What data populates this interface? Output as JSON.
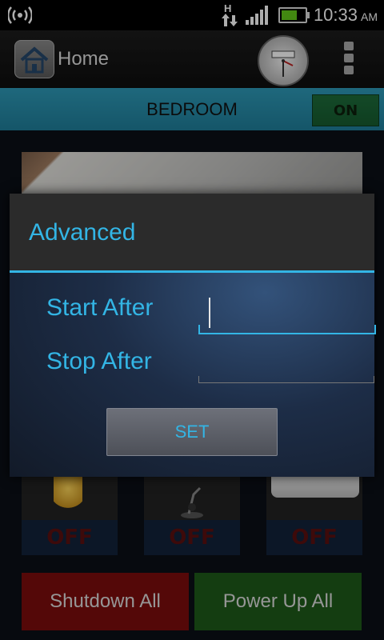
{
  "statusbar": {
    "time": "10:33",
    "ampm": "AM",
    "network_letter": "H"
  },
  "actionbar": {
    "title": "Home"
  },
  "room": {
    "name": "BEDROOM",
    "toggle_label": "ON"
  },
  "devices": [
    {
      "state": "OFF"
    },
    {
      "state": "OFF"
    },
    {
      "state": "OFF"
    }
  ],
  "buttons": {
    "shutdown_all": "Shutdown All",
    "power_up_all": "Power Up All"
  },
  "dialog": {
    "title": "Advanced",
    "start_label": "Start After",
    "start_value": "",
    "stop_label": "Stop After",
    "stop_value": "",
    "set_label": "SET"
  },
  "colors": {
    "accent": "#33b5e5",
    "off_text": "#5a0f0f",
    "shutdown": "#7d0d0d",
    "powerup": "#1e5a1a"
  }
}
